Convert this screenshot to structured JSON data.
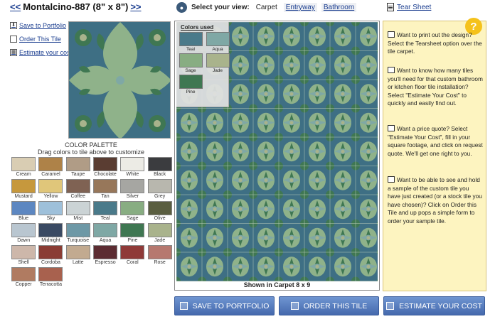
{
  "header": {
    "prev": "<<",
    "title": "Montalcino-887 (8\" x 8\")",
    "next": ">>"
  },
  "view": {
    "label": "Select your view:",
    "options": [
      "Carpet",
      "Entryway",
      "Bathroom"
    ]
  },
  "tearsheet": "Tear Sheet",
  "side_links": [
    "Save to Portfolio",
    "Order This Tile",
    "Estimate your cost"
  ],
  "palette": {
    "title": "COLOR PALETTE",
    "subtitle": "Drag colors to tile above to customize",
    "colors": [
      {
        "name": "Cream",
        "hex": "#d9cdb3"
      },
      {
        "name": "Caramel",
        "hex": "#ae8248"
      },
      {
        "name": "Taupe",
        "hex": "#b09c86"
      },
      {
        "name": "Chocolate",
        "hex": "#5a3d32"
      },
      {
        "name": "White",
        "hex": "#ecebe5"
      },
      {
        "name": "Black",
        "hex": "#3b3c3f"
      },
      {
        "name": "Mustard",
        "hex": "#c6983d"
      },
      {
        "name": "Yellow",
        "hex": "#e0c67a"
      },
      {
        "name": "Coffee",
        "hex": "#7f6253"
      },
      {
        "name": "Tan",
        "hex": "#97775a"
      },
      {
        "name": "Silver",
        "hex": "#a6a6a2"
      },
      {
        "name": "Grey",
        "hex": "#b8b7ae"
      },
      {
        "name": "Blue",
        "hex": "#5d87c1"
      },
      {
        "name": "Sky",
        "hex": "#9ec0da"
      },
      {
        "name": "Mist",
        "hex": "#cbd3d5"
      },
      {
        "name": "Teal",
        "hex": "#4a7a8a"
      },
      {
        "name": "Sage",
        "hex": "#88ad82"
      },
      {
        "name": "Olive",
        "hex": "#5a5e40"
      },
      {
        "name": "Dawn",
        "hex": "#b9c6d0"
      },
      {
        "name": "Midnight",
        "hex": "#3a4a63"
      },
      {
        "name": "Turquoise",
        "hex": "#6d98a6"
      },
      {
        "name": "Aqua",
        "hex": "#7fa8a5"
      },
      {
        "name": "Pine",
        "hex": "#3f7752"
      },
      {
        "name": "Jade",
        "hex": "#a9b38c"
      },
      {
        "name": "Shell",
        "hex": "#cdb7aa"
      },
      {
        "name": "Cordoba",
        "hex": "#8a3c34"
      },
      {
        "name": "Latte",
        "hex": "#c2aa90"
      },
      {
        "name": "Espresso",
        "hex": "#5c2c32"
      },
      {
        "name": "Coral",
        "hex": "#8f3a38"
      },
      {
        "name": "Rose",
        "hex": "#b6786f"
      },
      {
        "name": "Copper",
        "hex": "#b07b61"
      },
      {
        "name": "Terracotta",
        "hex": "#a8614e"
      }
    ]
  },
  "colors_used": {
    "title": "Colors used",
    "colors": [
      {
        "name": "Teal",
        "hex": "#4a7a8a"
      },
      {
        "name": "Aqua",
        "hex": "#7fa8a5"
      },
      {
        "name": "Sage",
        "hex": "#88ad82"
      },
      {
        "name": "Jade",
        "hex": "#a9b38c"
      },
      {
        "name": "Pine",
        "hex": "#3f7752"
      }
    ]
  },
  "carpet_caption": "Shown in Carpet 8 x 9",
  "help": {
    "items": [
      "Want to print out the design? Select the Tearsheet option over the tile carpet.",
      "Want to know how many tiles you'll need for that custom bathroom or kitchen floor tile installation? Select \"Estimate Your Cost\" to quickly and easily find out.",
      "Want a price quote? Select \"Estimate Your Cost\", fill in your square footage, and click on request quote. We'll get one right to you.",
      "Want to be able to see and hold a sample of the custom tile you have just created (or a stock tile you have chosen)? Click on Order this Tile and up pops a simple form to order your sample tile."
    ]
  },
  "buttons": {
    "save": "SAVE TO PORTFOLIO",
    "order": "ORDER THIS TILE",
    "estimate": "ESTIMATE YOUR COST"
  },
  "theme": {
    "link": "#1a3d8f",
    "button": "#5a80c2",
    "help_bg": "#fdf4c0",
    "tile_teal": "#3e6f84",
    "tile_sage": "#8fb28a",
    "tile_pine": "#3f7752"
  }
}
